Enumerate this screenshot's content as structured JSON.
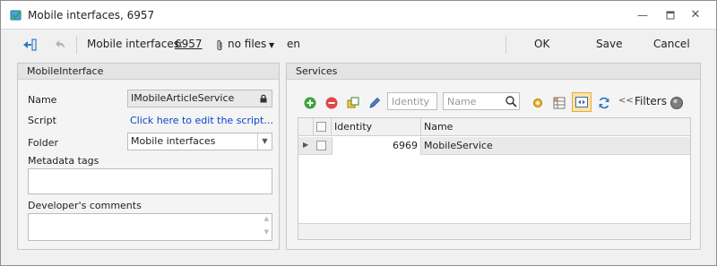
{
  "window": {
    "title": "Mobile interfaces, 6957",
    "icon": "app-icon",
    "controls": [
      "minimize-icon",
      "restore-icon",
      "close-icon"
    ]
  },
  "toolbar": {
    "breadcrumb_label": "Mobile interfaces:",
    "record_id": "6957",
    "attachments_label": "no files",
    "language": "en",
    "ok_label": "OK",
    "save_label": "Save",
    "cancel_label": "Cancel"
  },
  "mobile_interface": {
    "header": "MobileInterface",
    "name_label": "Name",
    "name_value": "IMobileArticleService",
    "script_label": "Script",
    "script_link": "Click here to edit the script...",
    "folder_label": "Folder",
    "folder_value": "Mobile interfaces",
    "metadata_label": "Metadata tags",
    "metadata_value": "",
    "comments_label": "Developer's comments",
    "comments_value": ""
  },
  "services": {
    "header": "Services",
    "identity_placeholder": "Identity",
    "name_placeholder": "Name",
    "filters_label": "Filters",
    "columns": [
      "Identity",
      "Name"
    ],
    "rows": [
      {
        "identity": "6969",
        "name": "MobileService"
      }
    ]
  }
}
